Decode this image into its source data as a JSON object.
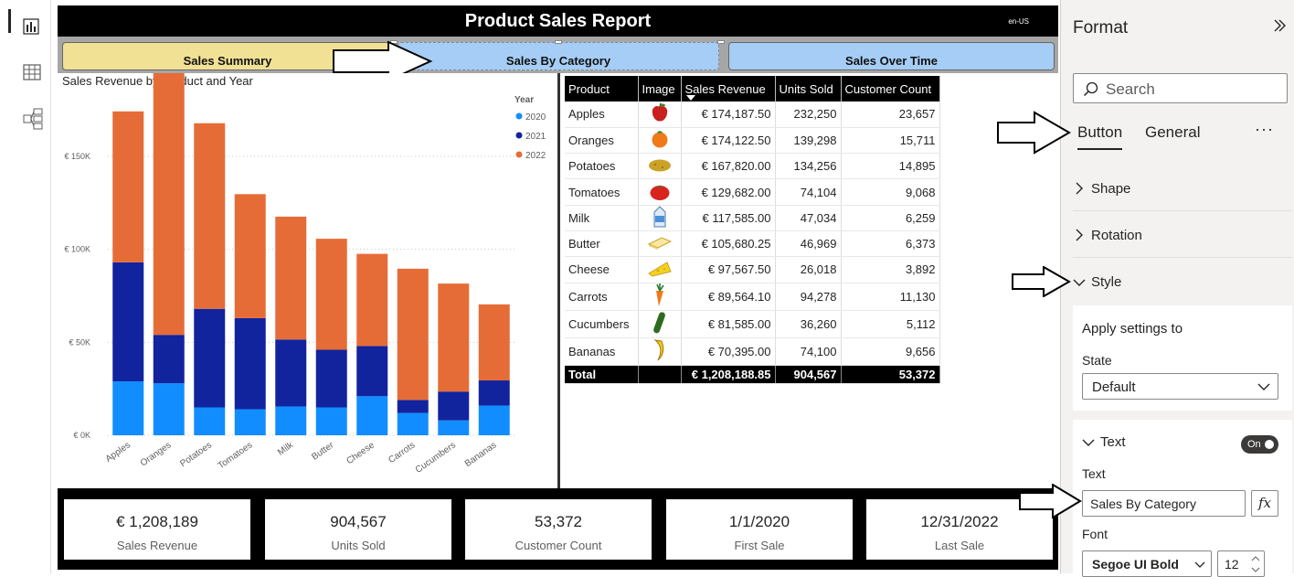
{
  "report": {
    "title": "Product Sales Report",
    "locale": "en-US",
    "tabs": [
      {
        "label": "Sales Summary",
        "color": "#f0e195"
      },
      {
        "label": "Sales By Category",
        "color": "#a5cdf5"
      },
      {
        "label": "Sales Over Time",
        "color": "#a5cdf5"
      }
    ]
  },
  "chart_data": {
    "type": "bar",
    "stacked": true,
    "title": "Sales Revenue by Product and Year",
    "legend_title": "Year",
    "legend_position": "top-right",
    "categories": [
      "Apples",
      "Oranges",
      "Potatoes",
      "Tomatoes",
      "Milk",
      "Butter",
      "Cheese",
      "Carrots",
      "Cucumbers",
      "Bananas"
    ],
    "series": [
      {
        "name": "2020",
        "color": "#118dff",
        "values": [
          29000,
          28000,
          15000,
          14000,
          15500,
          15000,
          21000,
          12000,
          8000,
          16000
        ]
      },
      {
        "name": "2021",
        "color": "#12239e",
        "values": [
          64000,
          26000,
          53000,
          49000,
          36000,
          31000,
          27000,
          7000,
          15500,
          13500
        ]
      },
      {
        "name": "2022",
        "color": "#e66c37",
        "values": [
          81187.5,
          148122.5,
          99820,
          66682,
          66085,
          59680.25,
          49567.5,
          70564.1,
          58085,
          40895
        ]
      }
    ],
    "ylim": [
      0,
      180000
    ],
    "yticks": [
      "€ 0K",
      "€ 50K",
      "€ 100K",
      "€ 150K"
    ],
    "ytick_values": [
      0,
      50000,
      100000,
      150000
    ],
    "grid": true
  },
  "matrix": {
    "headers": [
      "Product",
      "Image",
      "Sales Revenue",
      "Units Sold",
      "Customer Count"
    ],
    "rows": [
      {
        "product": "Apples",
        "icon": "apple-icon",
        "revenue": "€ 174,187.50",
        "units": "232,250",
        "customers": "23,657"
      },
      {
        "product": "Oranges",
        "icon": "orange-icon",
        "revenue": "€ 174,122.50",
        "units": "139,298",
        "customers": "15,711"
      },
      {
        "product": "Potatoes",
        "icon": "potato-icon",
        "revenue": "€ 167,820.00",
        "units": "134,256",
        "customers": "14,895"
      },
      {
        "product": "Tomatoes",
        "icon": "tomato-icon",
        "revenue": "€ 129,682.00",
        "units": "74,104",
        "customers": "9,068"
      },
      {
        "product": "Milk",
        "icon": "milk-carton-icon",
        "revenue": "€ 117,585.00",
        "units": "47,034",
        "customers": "6,259"
      },
      {
        "product": "Butter",
        "icon": "butter-icon",
        "revenue": "€ 105,680.25",
        "units": "46,969",
        "customers": "6,373"
      },
      {
        "product": "Cheese",
        "icon": "cheese-icon",
        "revenue": "€ 97,567.50",
        "units": "26,018",
        "customers": "3,892"
      },
      {
        "product": "Carrots",
        "icon": "carrot-icon",
        "revenue": "€ 89,564.10",
        "units": "94,278",
        "customers": "11,130"
      },
      {
        "product": "Cucumbers",
        "icon": "cucumber-icon",
        "revenue": "€ 81,585.00",
        "units": "36,260",
        "customers": "5,112"
      },
      {
        "product": "Bananas",
        "icon": "banana-icon",
        "revenue": "€ 70,395.00",
        "units": "74,100",
        "customers": "9,656"
      }
    ],
    "total": {
      "label": "Total",
      "revenue": "€ 1,208,188.85",
      "units": "904,567",
      "customers": "53,372"
    }
  },
  "kpis": [
    {
      "value": "€ 1,208,189",
      "label": "Sales Revenue"
    },
    {
      "value": "904,567",
      "label": "Units Sold"
    },
    {
      "value": "53,372",
      "label": "Customer Count"
    },
    {
      "value": "1/1/2020",
      "label": "First Sale"
    },
    {
      "value": "12/31/2022",
      "label": "Last Sale"
    }
  ],
  "format_pane": {
    "title": "Format",
    "search_placeholder": "Search",
    "tabs": [
      "Button",
      "General"
    ],
    "more": "···",
    "sections": [
      "Shape",
      "Rotation",
      "Style"
    ],
    "apply_settings_title": "Apply settings to",
    "state_label": "State",
    "state_value": "Default",
    "text_section": "Text",
    "toggle_label": "On",
    "text_label": "Text",
    "text_value": "Sales By Category",
    "fx_label": "fx",
    "font_label": "Font",
    "font_value": "Segoe UI Bold",
    "font_size": "12"
  }
}
